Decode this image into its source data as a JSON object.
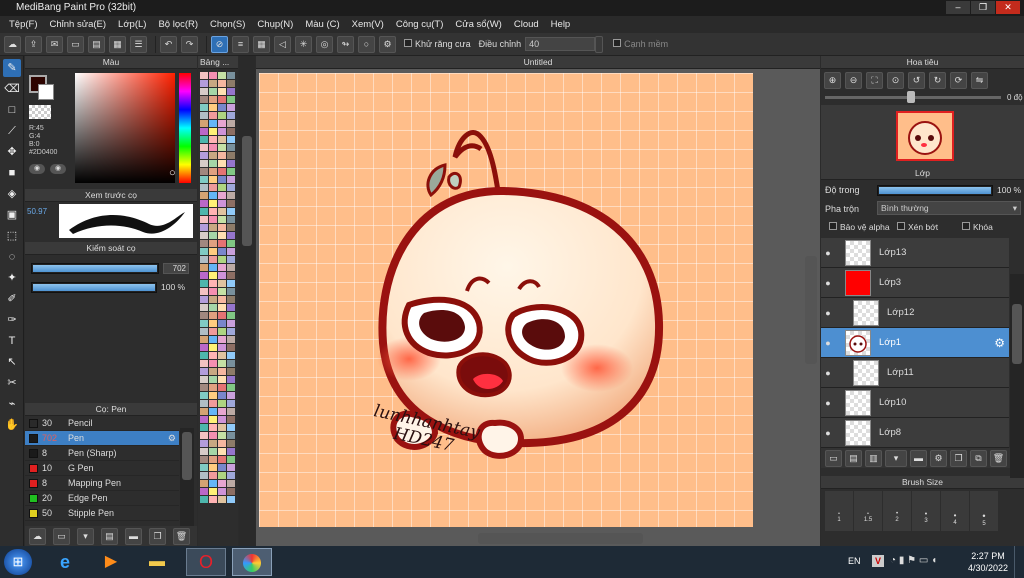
{
  "window": {
    "title": "MediBang Paint Pro (32bit)"
  },
  "menu": [
    "Tệp(F)",
    "Chỉnh sửa(E)",
    "Lớp(L)",
    "Bộ lọc(R)",
    "Chọn(S)",
    "Chụp(N)",
    "Màu (C)",
    "Xem(V)",
    "Công cụ(T)",
    "Cửa sổ(W)",
    "Cloud",
    "Help"
  ],
  "toolbar": {
    "antialias_label": "Khử răng cưa",
    "adjust_label": "Điều chỉnh",
    "adjust_value": "40",
    "snap_edge_label": "Cạnh mềm"
  },
  "color_panel": {
    "title": "Màu",
    "r": "R:45",
    "g": "G:4",
    "b": "B:0",
    "hex": "#2D0400",
    "primary": "#2D0400"
  },
  "palette_panel": {
    "title": "Bảng ..."
  },
  "preview_panel": {
    "title": "Xem trước cọ",
    "size": "50.97"
  },
  "brush_control": {
    "title": "Kiểm soát cọ",
    "size_value": "702",
    "opacity_value": "100 %",
    "size_fraction": 1.0,
    "opacity_fraction": 1.0
  },
  "brush_list": {
    "title": "Cọ: Pen",
    "items": [
      {
        "size": "30",
        "name": "Pencil",
        "color": "#2a2a2a"
      },
      {
        "size": "702",
        "name": "Pen",
        "color": "#1a1a1a",
        "selected": true
      },
      {
        "size": "8",
        "name": "Pen (Sharp)",
        "color": "#1a1a1a"
      },
      {
        "size": "10",
        "name": "G Pen",
        "color": "#e02020"
      },
      {
        "size": "8",
        "name": "Mapping Pen",
        "color": "#e02020"
      },
      {
        "size": "20",
        "name": "Edge Pen",
        "color": "#20c020"
      },
      {
        "size": "50",
        "name": "Stipple Pen",
        "color": "#e0d020"
      }
    ]
  },
  "canvas": {
    "tab": "Untitled",
    "signature_line1": "lunhhanhtay",
    "signature_line2": "HD247"
  },
  "navigator": {
    "title": "Hoa tiêu",
    "zoom": "0 độ"
  },
  "layer_panel": {
    "title": "Lớp",
    "opacity_label": "Độ trong",
    "opacity_value": "100 %",
    "opacity_fraction": 1.0,
    "blend_label": "Pha trộn",
    "blend_value": "Bình thường",
    "protect_alpha": "Bảo vệ alpha",
    "clipping": "Xén bớt",
    "lock": "Khóa",
    "layers": [
      {
        "name": "Lớp13",
        "type": "transparent"
      },
      {
        "name": "Lớp3",
        "type": "red"
      },
      {
        "name": "Lớp12",
        "type": "transparent",
        "indent": true
      },
      {
        "name": "Lớp1",
        "type": "face",
        "selected": true
      },
      {
        "name": "Lớp11",
        "type": "transparent",
        "indent": true
      },
      {
        "name": "Lớp10",
        "type": "transparent"
      },
      {
        "name": "Lớp8",
        "type": "transparent"
      }
    ]
  },
  "brush_size_panel": {
    "title": "Brush Size",
    "labels": [
      "1",
      "1.5",
      "2",
      "3",
      "4",
      "5"
    ]
  },
  "taskbar": {
    "lang": "EN",
    "time": "2:27 PM",
    "date": "4/30/2022"
  }
}
